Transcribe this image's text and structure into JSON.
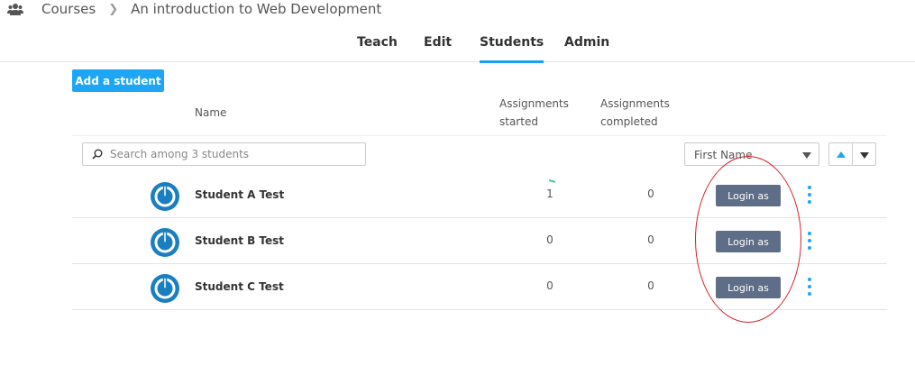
{
  "breadcrumb": {
    "icon": "users-icon",
    "items": [
      "Courses",
      "An introduction to Web Development"
    ],
    "separator": ">"
  },
  "tabs": [
    {
      "label": "Teach",
      "active": false
    },
    {
      "label": "Edit",
      "active": false
    },
    {
      "label": "Students",
      "active": true
    },
    {
      "label": "Admin",
      "active": false
    }
  ],
  "toolbar": {
    "add_student_label": "Add a student"
  },
  "table": {
    "headers": {
      "name": "Name",
      "started_line1": "Assignments",
      "started_line2": "started",
      "completed_line1": "Assignments",
      "completed_line2": "completed"
    },
    "search_placeholder": "Search among 3 students",
    "sort_field": "First Name",
    "rows": [
      {
        "name": "Student A Test",
        "started": "1",
        "completed": "0",
        "action": "Login as"
      },
      {
        "name": "Student B Test",
        "started": "0",
        "completed": "0",
        "action": "Login as"
      },
      {
        "name": "Student C Test",
        "started": "0",
        "completed": "0",
        "action": "Login as"
      }
    ]
  },
  "colors": {
    "accent": "#1ea6f5",
    "login_button": "#5f6e88",
    "avatar": "#1a7fc1",
    "annotation": "#d81f26"
  }
}
